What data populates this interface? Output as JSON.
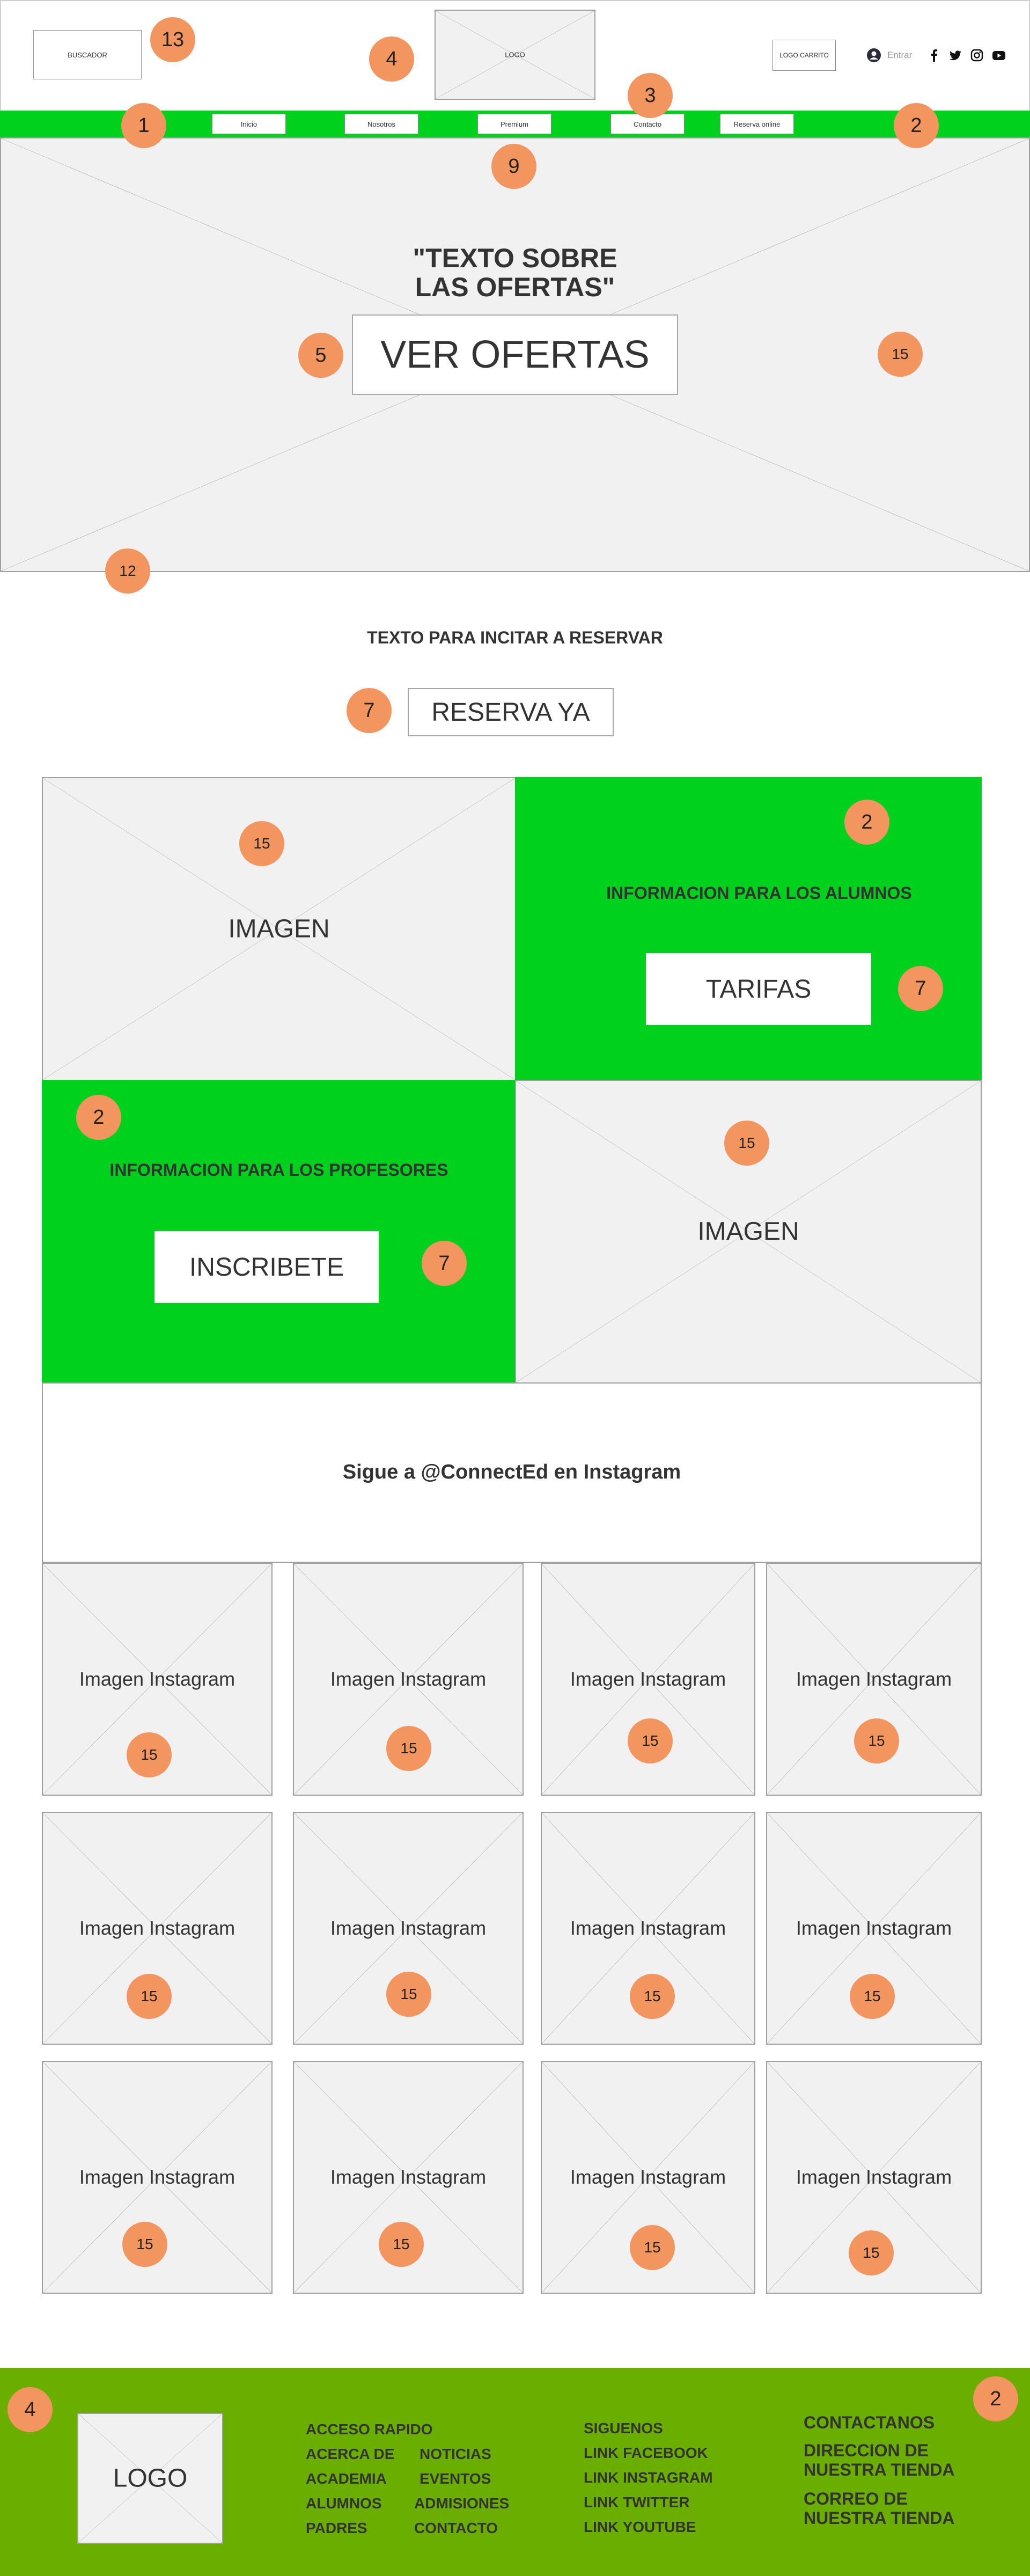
{
  "header": {
    "search_box": "BUSCADOR",
    "logo": "LOGO",
    "cart_logo": "LOGO CARRITO",
    "login_label": "Entrar",
    "social_icons": [
      "facebook-icon",
      "twitter-icon",
      "instagram-icon",
      "youtube-icon"
    ]
  },
  "nav": {
    "items": [
      {
        "label": "Inicio"
      },
      {
        "label": "Nosotros"
      },
      {
        "label": "Premium"
      },
      {
        "label": "Contacto"
      },
      {
        "label": "Reserva online"
      }
    ]
  },
  "hero": {
    "text_line1": "\"TEXTO SOBRE",
    "text_line2": "LAS OFERTAS\"",
    "button": "VER OFERTAS"
  },
  "reserve": {
    "text": "TEXTO PARA INCITAR A RESERVAR",
    "button": "RESERVA YA"
  },
  "grid": {
    "image1": "IMAGEN",
    "students_text": "INFORMACION PARA LOS ALUMNOS",
    "students_button": "TARIFAS",
    "teachers_text": "INFORMACION PARA LOS PROFESORES",
    "teachers_button": "INSCRIBETE",
    "image2": "IMAGEN"
  },
  "instagram": {
    "title": "Sigue a @ConnectEd en Instagram",
    "tile_label": "Imagen Instagram"
  },
  "footer": {
    "logo": "LOGO",
    "quick_title": "ACCESO RAPIDO",
    "quick_left": [
      "ACERCA DE",
      "ACADEMIA",
      "ALUMNOS",
      "PADRES"
    ],
    "quick_right": [
      "NOTICIAS",
      "EVENTOS",
      "ADMISIONES",
      "CONTACTO"
    ],
    "follow": [
      "SIGUENOS",
      "LINK FACEBOOK",
      "LINK INSTAGRAM",
      "LINK TWITTER",
      "LINK YOUTUBE"
    ],
    "contact": [
      "CONTACTANOS",
      "DIRECCION DE NUESTRA TIENDA",
      "CORREO DE NUESTRA TIENDA"
    ]
  },
  "badges": {
    "search": "13",
    "logo": "4",
    "contact_nav": "3",
    "nav_left": "1",
    "nav_right": "2",
    "nav_center": "9",
    "hero_button": "5",
    "hero_right": "15",
    "hero_bottom": "12",
    "reserve": "7",
    "image1": "15",
    "students_top": "2",
    "students_button": "7",
    "teachers_top": "2",
    "teachers_button": "7",
    "image2": "15",
    "instagram": "15",
    "footer_left": "4",
    "footer_right": "2"
  },
  "colors": {
    "nav_green": "#00d11c",
    "footer_green": "#6aae00",
    "badge_orange": "#f2955e",
    "placeholder_gray": "#f1f1f1"
  }
}
